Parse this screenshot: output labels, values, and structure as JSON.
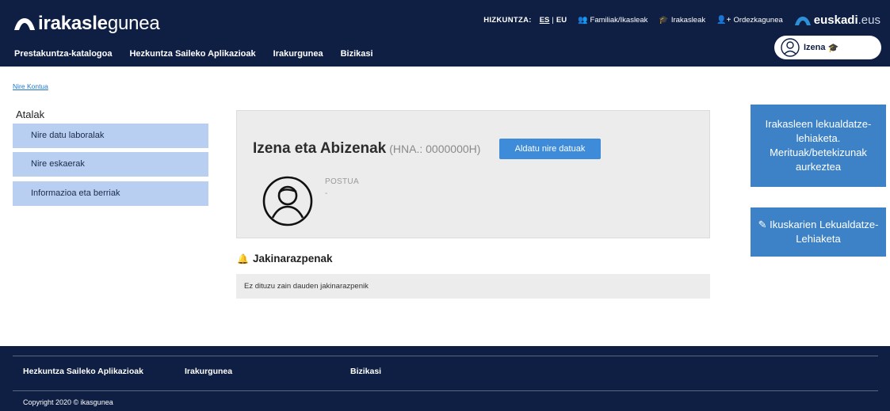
{
  "header": {
    "logo": {
      "bold": "irakasle",
      "light": "gunea"
    },
    "language_label": "HIZKUNTZA:",
    "languages": {
      "es": "ES",
      "sep": "|",
      "eu": "EU"
    },
    "top_links": {
      "families": "Familiak/Ikasleak",
      "teachers": "Irakasleak",
      "substitutes": "Ordezkagunea"
    },
    "euskadi": {
      "bold": "euskadi",
      "suffix": ".eus"
    },
    "nav": {
      "catalog": "Prestakuntza-katalogoa",
      "apps": "Hezkuntza Saileko Aplikazioak",
      "irakurgunea": "Irakurgunea",
      "bizikasi": "Bizikasi"
    },
    "user_button": "Izena"
  },
  "breadcrumb": "Nire Kontua",
  "sidebar": {
    "title": "Atalak",
    "items": [
      "Nire datu laboralak",
      "Nire eskaerak",
      "Informazioa eta berriak"
    ]
  },
  "profile": {
    "name": "Izena eta Abizenak",
    "hna": "(HNA.: 0000000H)",
    "edit_button": "Aldatu nire datuak",
    "post_label": "POSTUA",
    "post_value": "-"
  },
  "notifications": {
    "title": "Jakinarazpenak",
    "empty_message": "Ez dituzu zain dauden jakinarazpenik"
  },
  "tiles": {
    "transfer": "Irakasleen lekualdatze-lehiaketa. Merituak/betekizunak aurkeztea",
    "inspectors": "Ikuskarien Lekualdatze-Lehiaketa"
  },
  "footer": {
    "nav": {
      "apps": "Hezkuntza Saileko Aplikazioak",
      "irakurgunea": "Irakurgunea",
      "bizikasi": "Bizikasi"
    },
    "copyright": "Copyright 2020 © ikasgunea"
  },
  "colors": {
    "navy": "#0f1f43",
    "accent_blue": "#3d82c6",
    "sidebar_blue": "#b8cff2"
  }
}
